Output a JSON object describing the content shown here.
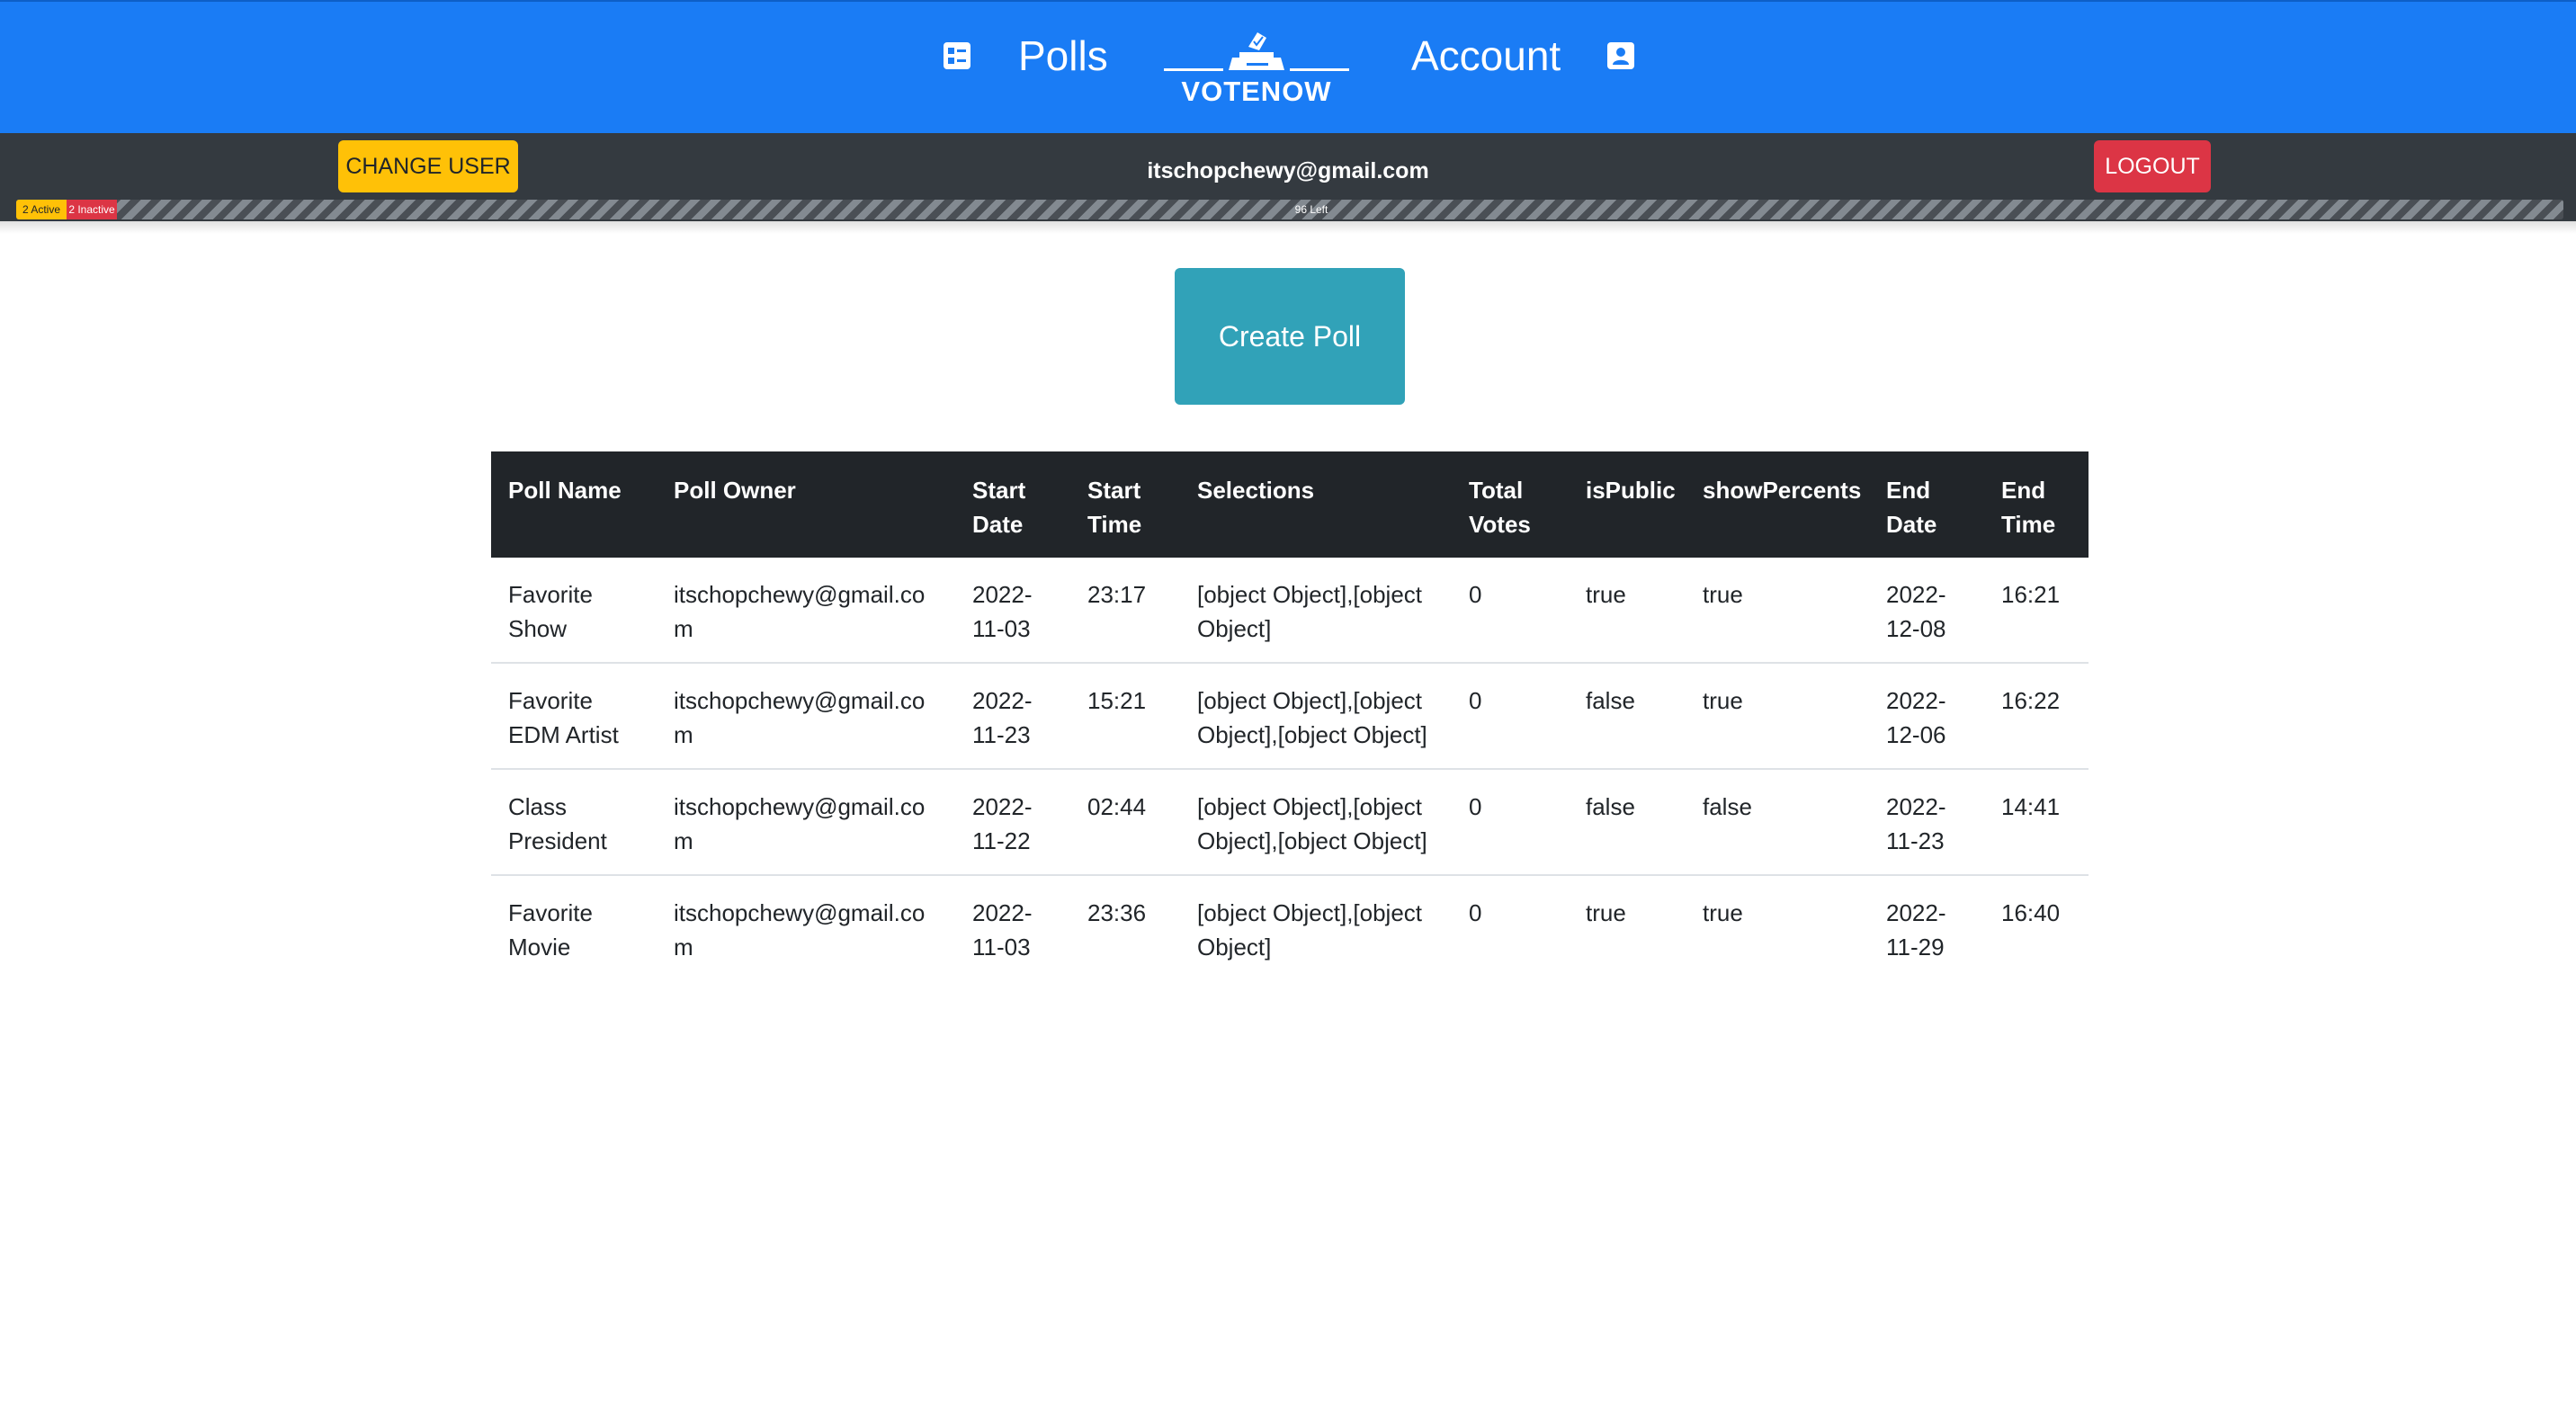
{
  "nav": {
    "polls_label": "Polls",
    "account_label": "Account",
    "logo_text": "VOTENOW",
    "polls_icon": "list-icon",
    "account_icon": "contact-card-icon",
    "bg_color": "#1a7cf5"
  },
  "userbar": {
    "change_user_label": "CHANGE USER",
    "email": "itschopchewy@gmail.com",
    "logout_label": "LOGOUT",
    "progress": {
      "active_label": "2 Active",
      "inactive_label": "2 Inactive",
      "left_label": "96 Left",
      "active_pct": 2,
      "inactive_pct": 2,
      "left_pct": 96
    }
  },
  "main": {
    "create_poll_label": "Create Poll"
  },
  "table": {
    "headers": [
      "Poll Name",
      "Poll Owner",
      "Start Date",
      "Start Time",
      "Selections",
      "Total Votes",
      "isPublic",
      "showPercents",
      "End Date",
      "End Time"
    ],
    "rows": [
      [
        "Favorite Show",
        "itschopchewy@gmail.com",
        "2022-11-03",
        "23:17",
        "[object Object],[object Object]",
        "0",
        "true",
        "true",
        "2022-12-08",
        "16:21"
      ],
      [
        "Favorite EDM Artist",
        "itschopchewy@gmail.com",
        "2022-11-23",
        "15:21",
        "[object Object],[object Object],[object Object]",
        "0",
        "false",
        "true",
        "2022-12-06",
        "16:22"
      ],
      [
        "Class President",
        "itschopchewy@gmail.com",
        "2022-11-22",
        "02:44",
        "[object Object],[object Object],[object Object]",
        "0",
        "false",
        "false",
        "2022-11-23",
        "14:41"
      ],
      [
        "Favorite Movie",
        "itschopchewy@gmail.com",
        "2022-11-03",
        "23:36",
        "[object Object],[object Object]",
        "0",
        "true",
        "true",
        "2022-11-29",
        "16:40"
      ]
    ]
  }
}
